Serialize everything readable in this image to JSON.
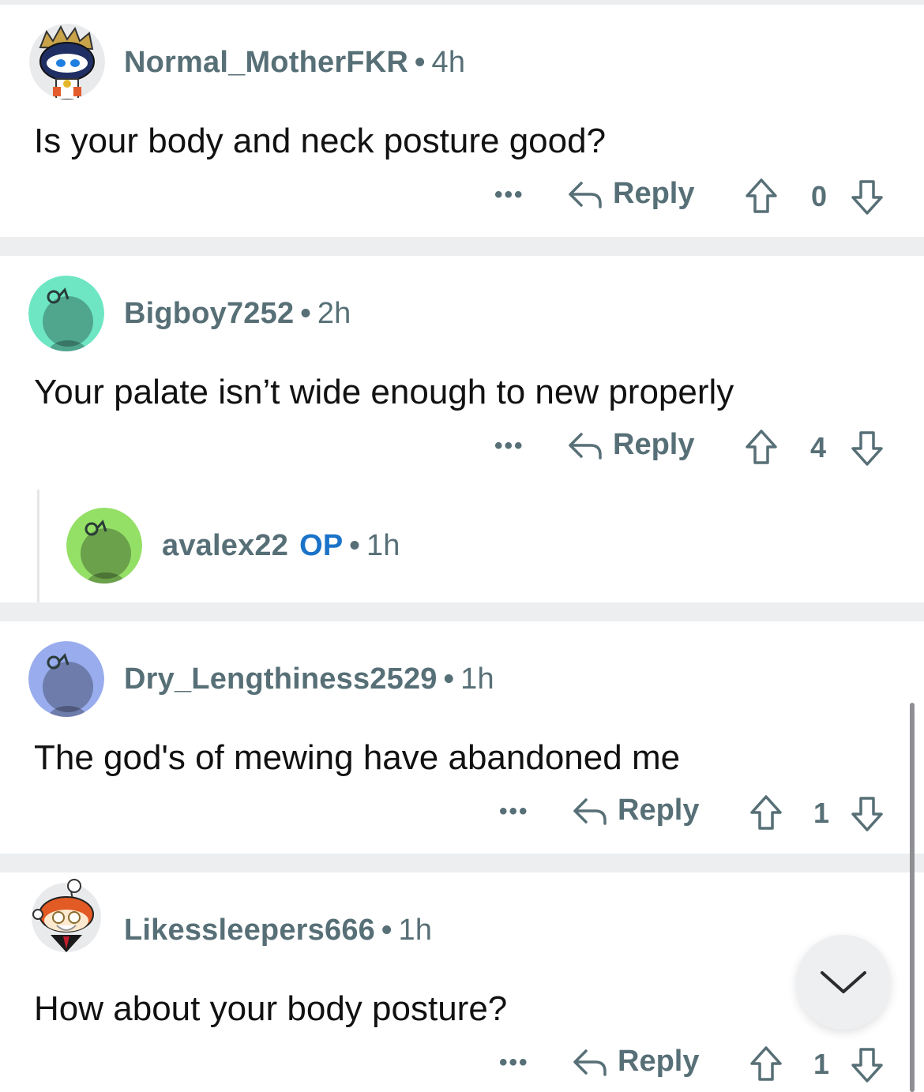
{
  "comments": [
    {
      "username": "Normal_MotherFKR",
      "time": "4h",
      "op_badge": "",
      "text": "Is your body and neck posture good?",
      "more_label": "•••",
      "reply_label": "Reply",
      "score": "0",
      "avatar": "custom-snoo-crown-avatar"
    },
    {
      "username": "Bigboy7252",
      "time": "2h",
      "op_badge": "",
      "text": "Your palate isn’t wide enough to new properly",
      "more_label": "•••",
      "reply_label": "Reply",
      "score": "4",
      "avatar": "default-snoo-avatar",
      "avatar_color": "#6ee6c4"
    },
    {
      "username": "avalex22",
      "time": "1h",
      "op_badge": "OP",
      "text": "",
      "avatar": "default-snoo-avatar",
      "avatar_color": "#94e067"
    },
    {
      "username": "Dry_Lengthiness2529",
      "time": "1h",
      "op_badge": "",
      "text": "The god's of mewing have abandoned me",
      "more_label": "•••",
      "reply_label": "Reply",
      "score": "1",
      "avatar": "default-snoo-avatar",
      "avatar_color": "#98acee"
    },
    {
      "username": "Likessleepers666",
      "time": "1h",
      "op_badge": "",
      "text": "How about your body posture?",
      "more_label": "•••",
      "reply_label": "Reply",
      "score": "1",
      "avatar": "custom-snoo-santa-avatar"
    }
  ],
  "separator_dot": "•",
  "jump_button": {
    "icon": "chevron-down-icon"
  },
  "colors": {
    "meta": "#576f76",
    "op": "#1a73c8",
    "separator": "#eceef0"
  }
}
